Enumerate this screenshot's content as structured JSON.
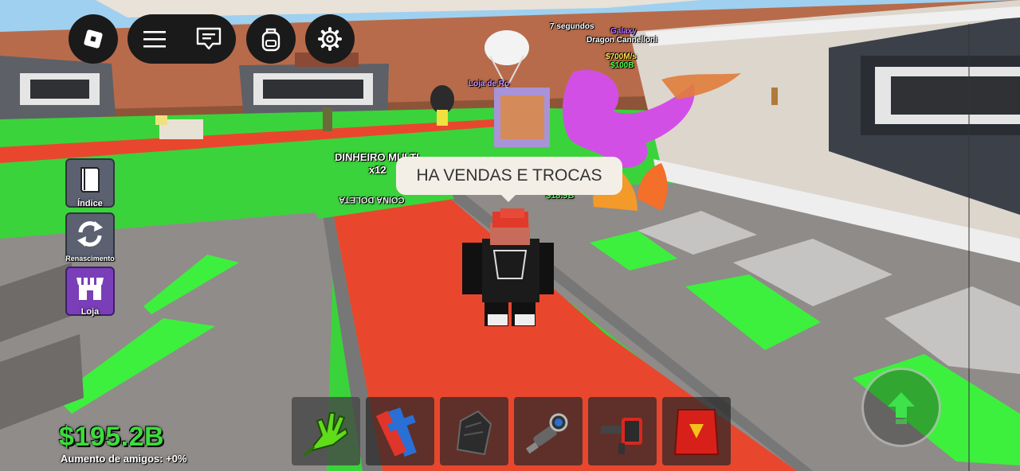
{
  "topbar": {
    "roblox_icon": "roblox-logo-icon",
    "menu_icon": "hamburger-menu-icon",
    "chat_icon": "chat-icon",
    "backpack_icon": "backpack-icon",
    "settings_icon": "gear-icon"
  },
  "sidebar": {
    "items": [
      {
        "label": "Índice",
        "icon": "book-icon"
      },
      {
        "label": "Renascimento",
        "icon": "rebirth-arrows-icon"
      },
      {
        "label": "Loja",
        "icon": "shop-icon"
      }
    ]
  },
  "world": {
    "chat_bubble": "HA VENDAS E TROCAS",
    "multiplier_title": "DINHEIRO MULTI",
    "multiplier_value": "x12",
    "brainrot_rarity": "Galaxy",
    "brainrot_name": "Dragon Cannelloni",
    "brainrot_income": "$700M/s",
    "brainrot_price": "$100B",
    "timer": "7 segundos",
    "shop_sign": "Loja de Ro",
    "floor_price": "$18.9B",
    "floor_text": "COINA DOLETA",
    "bubble_color": "#f4efe6",
    "carpet_color": "#e8472e",
    "grass_color": "#3bd33b"
  },
  "hud": {
    "money": "$195.2B",
    "friend_boost": "Aumento de amigos: +0%",
    "money_color": "#3cdc3c"
  },
  "hotbar": {
    "slots": [
      {
        "name": "green-slap-glove",
        "icon": "green-glove-icon"
      },
      {
        "name": "blue-red-tool",
        "icon": "blue-red-figure-icon"
      },
      {
        "name": "dark-cloak",
        "icon": "dark-cloak-icon"
      },
      {
        "name": "flashlight-tool",
        "icon": "flashlight-icon"
      },
      {
        "name": "red-turret",
        "icon": "red-turret-icon"
      },
      {
        "name": "red-cape",
        "icon": "red-cape-icon"
      }
    ]
  },
  "controls": {
    "jump_icon": "jump-arrow-icon"
  }
}
